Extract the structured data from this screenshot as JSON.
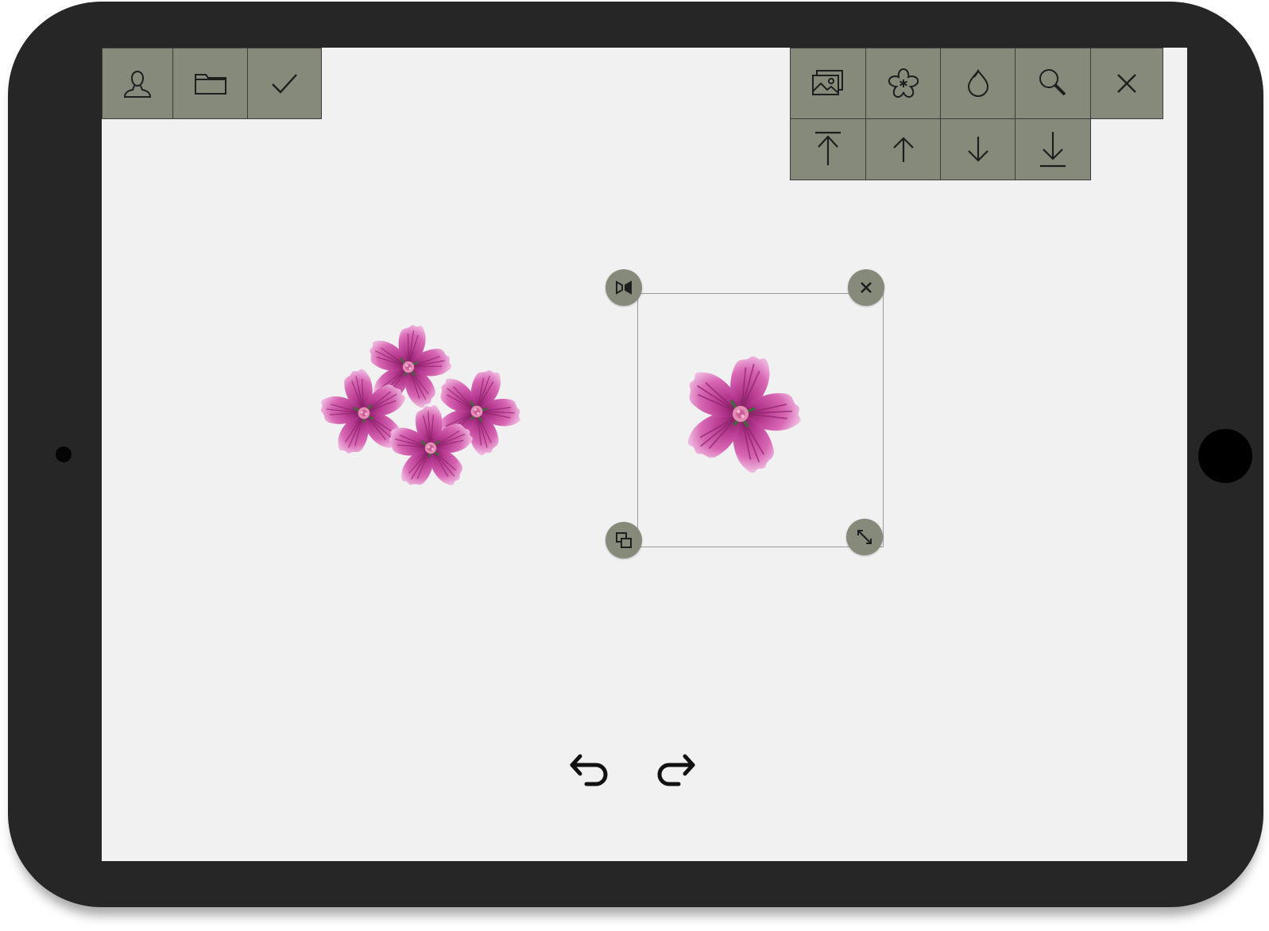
{
  "device": {
    "icons": {
      "camera": "camera-dot",
      "home": "home-button"
    }
  },
  "toolbar_left": {
    "buttons": [
      {
        "name": "profile",
        "icon": "user-icon"
      },
      {
        "name": "open",
        "icon": "folder-icon"
      },
      {
        "name": "confirm",
        "icon": "check-icon"
      }
    ]
  },
  "toolbar_right": {
    "row1": [
      {
        "name": "background",
        "icon": "image-icon"
      },
      {
        "name": "stickers",
        "icon": "flower-icon"
      },
      {
        "name": "color",
        "icon": "droplet-icon"
      },
      {
        "name": "zoom",
        "icon": "search-icon"
      },
      {
        "name": "close",
        "icon": "close-icon"
      }
    ],
    "row2": [
      {
        "name": "bring-to-front",
        "icon": "arrow-up-to-line-icon"
      },
      {
        "name": "bring-forward",
        "icon": "arrow-up-icon"
      },
      {
        "name": "send-backward",
        "icon": "arrow-down-icon"
      },
      {
        "name": "send-to-back",
        "icon": "arrow-down-to-line-icon"
      }
    ]
  },
  "canvas": {
    "background_color": "#f1f1f1",
    "toolbar_color": "#868a7b",
    "items": [
      {
        "name": "flower-cluster",
        "description_icon": "flower-cluster-sticker",
        "petal_color": "#c2439b"
      },
      {
        "name": "selected-flower",
        "description_icon": "flower-sticker",
        "petal_color": "#c2439b"
      }
    ],
    "selection_handles": [
      {
        "position": "top-left",
        "icon": "flip-icon"
      },
      {
        "position": "top-right",
        "icon": "close-icon"
      },
      {
        "position": "bottom-left",
        "icon": "duplicate-icon"
      },
      {
        "position": "bottom-right",
        "icon": "resize-icon"
      }
    ]
  },
  "history": {
    "undo_icon": "undo-icon",
    "redo_icon": "redo-icon"
  }
}
